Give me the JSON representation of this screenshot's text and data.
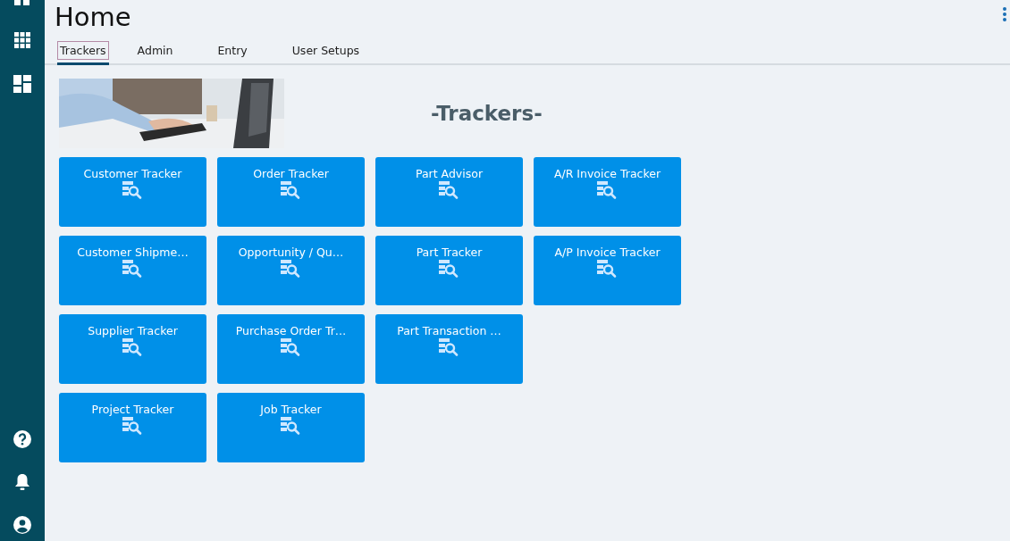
{
  "page": {
    "title": "Home"
  },
  "tabs": [
    {
      "label": "Trackers",
      "selected": true
    },
    {
      "label": "Admin",
      "selected": false
    },
    {
      "label": "Entry",
      "selected": false
    },
    {
      "label": "User Setups",
      "selected": false
    }
  ],
  "banner": {
    "kind": "picture",
    "heading": "-Trackers-"
  },
  "tile_rows": [
    [
      {
        "label": "Customer Tracker"
      },
      {
        "label": "Order Tracker"
      },
      {
        "label": "Part Advisor"
      },
      {
        "label": "A/R Invoice Tracker"
      }
    ],
    [
      {
        "label": "Customer Shipme…"
      },
      {
        "label": "Opportunity / Qu…"
      },
      {
        "label": "Part Tracker"
      },
      {
        "label": "A/P Invoice Tracker"
      }
    ],
    [
      {
        "label": "Supplier Tracker"
      },
      {
        "label": "Purchase Order Tr…"
      },
      {
        "label": "Part Transaction …"
      }
    ],
    [
      {
        "label": "Project Tracker"
      },
      {
        "label": "Job Tracker"
      }
    ]
  ]
}
